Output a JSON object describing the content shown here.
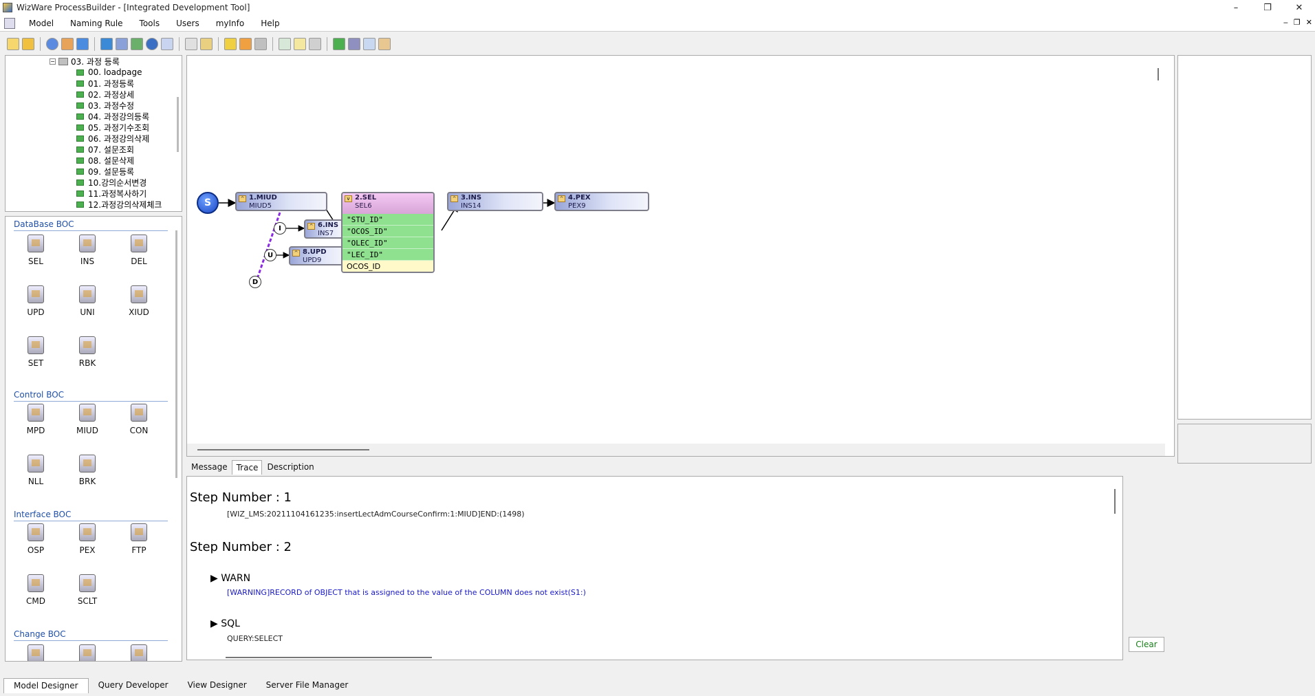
{
  "window": {
    "title": "WizWare ProcessBuilder - [Integrated Development Tool]",
    "minimize": "–",
    "restore": "❐",
    "close": "✕"
  },
  "menu": [
    "Model",
    "Naming Rule",
    "Tools",
    "Users",
    "myInfo",
    "Help"
  ],
  "mdi": {
    "minimize": "‒",
    "restore": "❐",
    "close": "✕"
  },
  "tree": {
    "parent": "03. 과정 등록",
    "items": [
      "00. loadpage",
      "01. 과정등록",
      "02. 과정상세",
      "03. 과정수정",
      "04. 과정강의등록",
      "05. 과정기수조회",
      "06. 과정강의삭제",
      "07. 설문조회",
      "08. 설문삭제",
      "09. 설문등록",
      "10.강의순서변경",
      "11.과정복사하기",
      "12.과정강의삭제체크"
    ]
  },
  "palette": {
    "database": {
      "title": "DataBase BOC",
      "items": [
        "SEL",
        "INS",
        "DEL",
        "UPD",
        "UNI",
        "XIUD",
        "SET",
        "RBK"
      ]
    },
    "control": {
      "title": "Control BOC",
      "items": [
        "MPD",
        "MIUD",
        "CON",
        "NLL",
        "BRK"
      ]
    },
    "interface": {
      "title": "Interface BOC",
      "items": [
        "OSP",
        "PEX",
        "FTP",
        "CMD",
        "SCLT"
      ]
    },
    "change": {
      "title": "Change BOC"
    }
  },
  "diagram": {
    "start": "S",
    "nodes": {
      "miud": {
        "label": "1.MIUD",
        "sub": "MIUD5"
      },
      "sel": {
        "label": "2.SEL",
        "sub": "SEL6",
        "columns": [
          "\"STU_ID\"",
          "\"OCOS_ID\"",
          "\"OLEC_ID\"",
          "\"LEC_ID\""
        ],
        "extra": "OCOS_ID"
      },
      "ins": {
        "label": "3.INS",
        "sub": "INS14"
      },
      "pex": {
        "label": "4.PEX",
        "sub": "PEX9"
      },
      "ins7": {
        "label": "6.INS",
        "sub": "INS7"
      },
      "upd": {
        "label": "8.UPD",
        "sub": "UPD9"
      }
    },
    "branch": {
      "i": "I",
      "u": "U",
      "d": "D"
    }
  },
  "tabs": [
    "Message",
    "Trace",
    "Description"
  ],
  "trace": {
    "step1": "Step Number : 1",
    "step1_detail": "[WIZ_LMS:20211104161235:insertLectAdmCourseConfirm:1:MIUD]END:(1498)",
    "step2": "Step Number : 2",
    "warn_head": "WARN",
    "warn_text": "[WARNING]RECORD of OBJECT that is assigned to the value of the COLUMN does not exist(S1:)",
    "sql_head": "SQL",
    "sql_text": "QUERY:SELECT"
  },
  "clear_label": "Clear",
  "bottom_tabs": [
    "Model Designer",
    "Query Developer",
    "View Designer",
    "Server File Manager"
  ]
}
